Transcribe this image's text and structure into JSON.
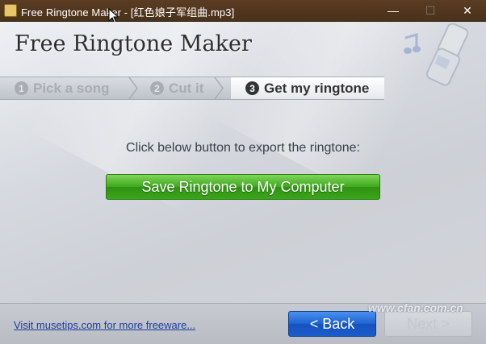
{
  "window": {
    "title": "Free Ringtone Maker - [红色娘子军组曲.mp3]",
    "controls": {
      "minimize": "—",
      "maximize": "☐",
      "close": "✕"
    }
  },
  "header": {
    "app_title": "Free Ringtone Maker"
  },
  "steps": [
    {
      "num": "1",
      "label": "Pick a song",
      "active": false
    },
    {
      "num": "2",
      "label": "Cut it",
      "active": false
    },
    {
      "num": "3",
      "label": "Get my ringtone",
      "active": true
    }
  ],
  "main": {
    "instruction": "Click below button to export the ringtone:",
    "save_button": "Save Ringtone to My Computer"
  },
  "footer": {
    "link": "Visit musetips.com for more freeware...",
    "back_button": "< Back",
    "next_button": "Next >"
  },
  "watermark": "www.cfan.com.cn",
  "colors": {
    "titlebar": "#4e341c",
    "save_button": "#3ea81c",
    "back_button": "#1e62d0",
    "link": "#1d3f9e"
  }
}
